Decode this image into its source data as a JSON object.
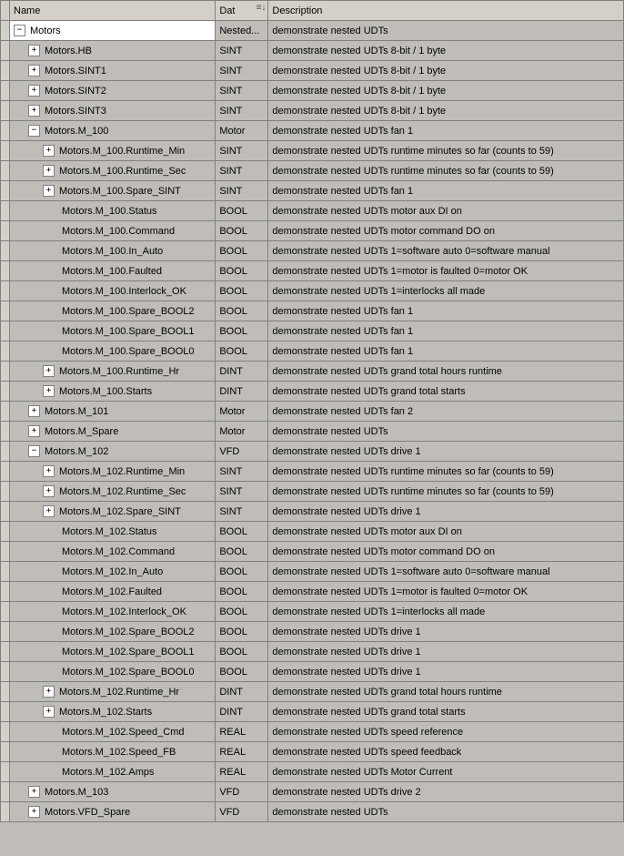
{
  "headers": {
    "name": "Name",
    "datatype": "Dat",
    "description": "Description"
  },
  "rows": [
    {
      "indent": 0,
      "node": "-",
      "name": "Motors",
      "datatype": "Nested...",
      "desc": "demonstrate nested UDTs",
      "first": true
    },
    {
      "indent": 1,
      "node": "+",
      "name": "Motors.HB",
      "datatype": "SINT",
      "desc": "demonstrate nested UDTs 8-bit / 1 byte"
    },
    {
      "indent": 1,
      "node": "+",
      "name": "Motors.SINT1",
      "datatype": "SINT",
      "desc": "demonstrate nested UDTs 8-bit / 1 byte"
    },
    {
      "indent": 1,
      "node": "+",
      "name": "Motors.SINT2",
      "datatype": "SINT",
      "desc": "demonstrate nested UDTs 8-bit / 1 byte"
    },
    {
      "indent": 1,
      "node": "+",
      "name": "Motors.SINT3",
      "datatype": "SINT",
      "desc": "demonstrate nested UDTs 8-bit / 1 byte"
    },
    {
      "indent": 1,
      "node": "-",
      "name": "Motors.M_100",
      "datatype": "Motor",
      "desc": "demonstrate nested UDTs fan 1"
    },
    {
      "indent": 2,
      "node": "+",
      "name": "Motors.M_100.Runtime_Min",
      "datatype": "SINT",
      "desc": "demonstrate nested UDTs runtime minutes so far (counts to 59)"
    },
    {
      "indent": 2,
      "node": "+",
      "name": "Motors.M_100.Runtime_Sec",
      "datatype": "SINT",
      "desc": "demonstrate nested UDTs runtime minutes so far (counts to 59)"
    },
    {
      "indent": 2,
      "node": "+",
      "name": "Motors.M_100.Spare_SINT",
      "datatype": "SINT",
      "desc": "demonstrate nested UDTs fan 1"
    },
    {
      "indent": 2,
      "node": "",
      "name": "Motors.M_100.Status",
      "datatype": "BOOL",
      "desc": "demonstrate nested UDTs motor aux DI on"
    },
    {
      "indent": 2,
      "node": "",
      "name": "Motors.M_100.Command",
      "datatype": "BOOL",
      "desc": "demonstrate nested UDTs motor command DO on"
    },
    {
      "indent": 2,
      "node": "",
      "name": "Motors.M_100.In_Auto",
      "datatype": "BOOL",
      "desc": "demonstrate nested UDTs 1=software auto 0=software manual"
    },
    {
      "indent": 2,
      "node": "",
      "name": "Motors.M_100.Faulted",
      "datatype": "BOOL",
      "desc": "demonstrate nested UDTs 1=motor is faulted 0=motor OK"
    },
    {
      "indent": 2,
      "node": "",
      "name": "Motors.M_100.Interlock_OK",
      "datatype": "BOOL",
      "desc": "demonstrate nested UDTs 1=interlocks all made"
    },
    {
      "indent": 2,
      "node": "",
      "name": "Motors.M_100.Spare_BOOL2",
      "datatype": "BOOL",
      "desc": "demonstrate nested UDTs fan 1"
    },
    {
      "indent": 2,
      "node": "",
      "name": "Motors.M_100.Spare_BOOL1",
      "datatype": "BOOL",
      "desc": "demonstrate nested UDTs fan 1"
    },
    {
      "indent": 2,
      "node": "",
      "name": "Motors.M_100.Spare_BOOL0",
      "datatype": "BOOL",
      "desc": "demonstrate nested UDTs fan 1"
    },
    {
      "indent": 2,
      "node": "+",
      "name": "Motors.M_100.Runtime_Hr",
      "datatype": "DINT",
      "desc": "demonstrate nested UDTs grand total hours runtime"
    },
    {
      "indent": 2,
      "node": "+",
      "name": "Motors.M_100.Starts",
      "datatype": "DINT",
      "desc": "demonstrate nested UDTs grand total starts"
    },
    {
      "indent": 1,
      "node": "+",
      "name": "Motors.M_101",
      "datatype": "Motor",
      "desc": "demonstrate nested UDTs fan 2"
    },
    {
      "indent": 1,
      "node": "+",
      "name": "Motors.M_Spare",
      "datatype": "Motor",
      "desc": "demonstrate nested UDTs"
    },
    {
      "indent": 1,
      "node": "-",
      "name": "Motors.M_102",
      "datatype": "VFD",
      "desc": "demonstrate nested UDTs drive 1"
    },
    {
      "indent": 2,
      "node": "+",
      "name": "Motors.M_102.Runtime_Min",
      "datatype": "SINT",
      "desc": "demonstrate nested UDTs runtime minutes so far (counts to 59)"
    },
    {
      "indent": 2,
      "node": "+",
      "name": "Motors.M_102.Runtime_Sec",
      "datatype": "SINT",
      "desc": "demonstrate nested UDTs runtime minutes so far (counts to 59)"
    },
    {
      "indent": 2,
      "node": "+",
      "name": "Motors.M_102.Spare_SINT",
      "datatype": "SINT",
      "desc": "demonstrate nested UDTs drive 1"
    },
    {
      "indent": 2,
      "node": "",
      "name": "Motors.M_102.Status",
      "datatype": "BOOL",
      "desc": "demonstrate nested UDTs motor aux DI on"
    },
    {
      "indent": 2,
      "node": "",
      "name": "Motors.M_102.Command",
      "datatype": "BOOL",
      "desc": "demonstrate nested UDTs motor command DO on"
    },
    {
      "indent": 2,
      "node": "",
      "name": "Motors.M_102.In_Auto",
      "datatype": "BOOL",
      "desc": "demonstrate nested UDTs 1=software auto 0=software manual"
    },
    {
      "indent": 2,
      "node": "",
      "name": "Motors.M_102.Faulted",
      "datatype": "BOOL",
      "desc": "demonstrate nested UDTs 1=motor is faulted 0=motor OK"
    },
    {
      "indent": 2,
      "node": "",
      "name": "Motors.M_102.Interlock_OK",
      "datatype": "BOOL",
      "desc": "demonstrate nested UDTs 1=interlocks all made"
    },
    {
      "indent": 2,
      "node": "",
      "name": "Motors.M_102.Spare_BOOL2",
      "datatype": "BOOL",
      "desc": "demonstrate nested UDTs drive 1"
    },
    {
      "indent": 2,
      "node": "",
      "name": "Motors.M_102.Spare_BOOL1",
      "datatype": "BOOL",
      "desc": "demonstrate nested UDTs drive 1"
    },
    {
      "indent": 2,
      "node": "",
      "name": "Motors.M_102.Spare_BOOL0",
      "datatype": "BOOL",
      "desc": "demonstrate nested UDTs drive 1"
    },
    {
      "indent": 2,
      "node": "+",
      "name": "Motors.M_102.Runtime_Hr",
      "datatype": "DINT",
      "desc": "demonstrate nested UDTs grand total hours runtime"
    },
    {
      "indent": 2,
      "node": "+",
      "name": "Motors.M_102.Starts",
      "datatype": "DINT",
      "desc": "demonstrate nested UDTs grand total starts"
    },
    {
      "indent": 2,
      "node": "",
      "name": "Motors.M_102.Speed_Cmd",
      "datatype": "REAL",
      "desc": "demonstrate nested UDTs speed reference"
    },
    {
      "indent": 2,
      "node": "",
      "name": "Motors.M_102.Speed_FB",
      "datatype": "REAL",
      "desc": "demonstrate nested UDTs speed feedback"
    },
    {
      "indent": 2,
      "node": "",
      "name": "Motors.M_102.Amps",
      "datatype": "REAL",
      "desc": "demonstrate nested UDTs Motor Current"
    },
    {
      "indent": 1,
      "node": "+",
      "name": "Motors.M_103",
      "datatype": "VFD",
      "desc": "demonstrate nested UDTs drive 2"
    },
    {
      "indent": 1,
      "node": "+",
      "name": "Motors.VFD_Spare",
      "datatype": "VFD",
      "desc": "demonstrate nested UDTs"
    }
  ]
}
